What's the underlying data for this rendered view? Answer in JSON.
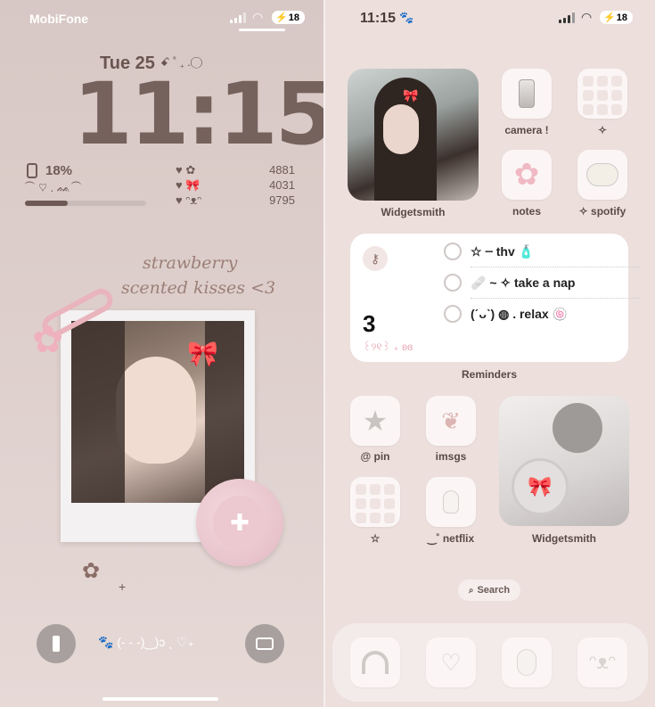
{
  "lock": {
    "carrier": "MobiFone",
    "battery": "18",
    "date": "Tue 25",
    "date_decor": "ꗃ ˚ ₊ .◯",
    "time": "11:15",
    "phone_battery": "18%",
    "decor_line": "⁀ ♡ . ᨐ⁀",
    "progress": 0.35,
    "stats": [
      {
        "icons": "♥ ✿",
        "value": "4881"
      },
      {
        "icons": "♥ 🎀",
        "value": "4031"
      },
      {
        "icons": "♥ ᵔᴥᵔ",
        "value": "9795"
      }
    ],
    "script_line1": "strawberry",
    "script_line2": "scented kisses <3",
    "flower_glyph": "✿",
    "plus_glyph": "+",
    "bottom_text": "🐾 (- - -)‿)ↄ ˎ ♡₊",
    "flashlight_icon": "flashlight-icon",
    "camera_icon": "camera-icon"
  },
  "home": {
    "time": "11:15",
    "paw": "🐾",
    "battery": "18",
    "apps": [
      {
        "label": "camera !"
      },
      {
        "label": "✧"
      },
      {
        "label": "notes"
      },
      {
        "label": "✧ spotify"
      },
      {
        "label": "@ pin"
      },
      {
        "label": "imsgs"
      },
      {
        "label": "☆"
      },
      {
        "label": "‿˚ netflix"
      }
    ],
    "photo_widget_1_label": "Widgetsmith",
    "photo_widget_2_label": "Widgetsmith",
    "reminders": {
      "label": "Reminders",
      "count": "3",
      "decor": "꒰୨୧꒱ ₊ ʚɞ",
      "items": [
        "☆ ┈ thv 🧴",
        "🩹 ~ ✧ take a nap",
        "(ˊᴗˋ) ◍ . relax 🍥"
      ]
    },
    "search_label": "Search"
  },
  "colors": {
    "lock_bg": "#dacac7",
    "time": "#76625d",
    "accent_pink": "#e9b9c0",
    "widget_white": "#ffffff"
  }
}
